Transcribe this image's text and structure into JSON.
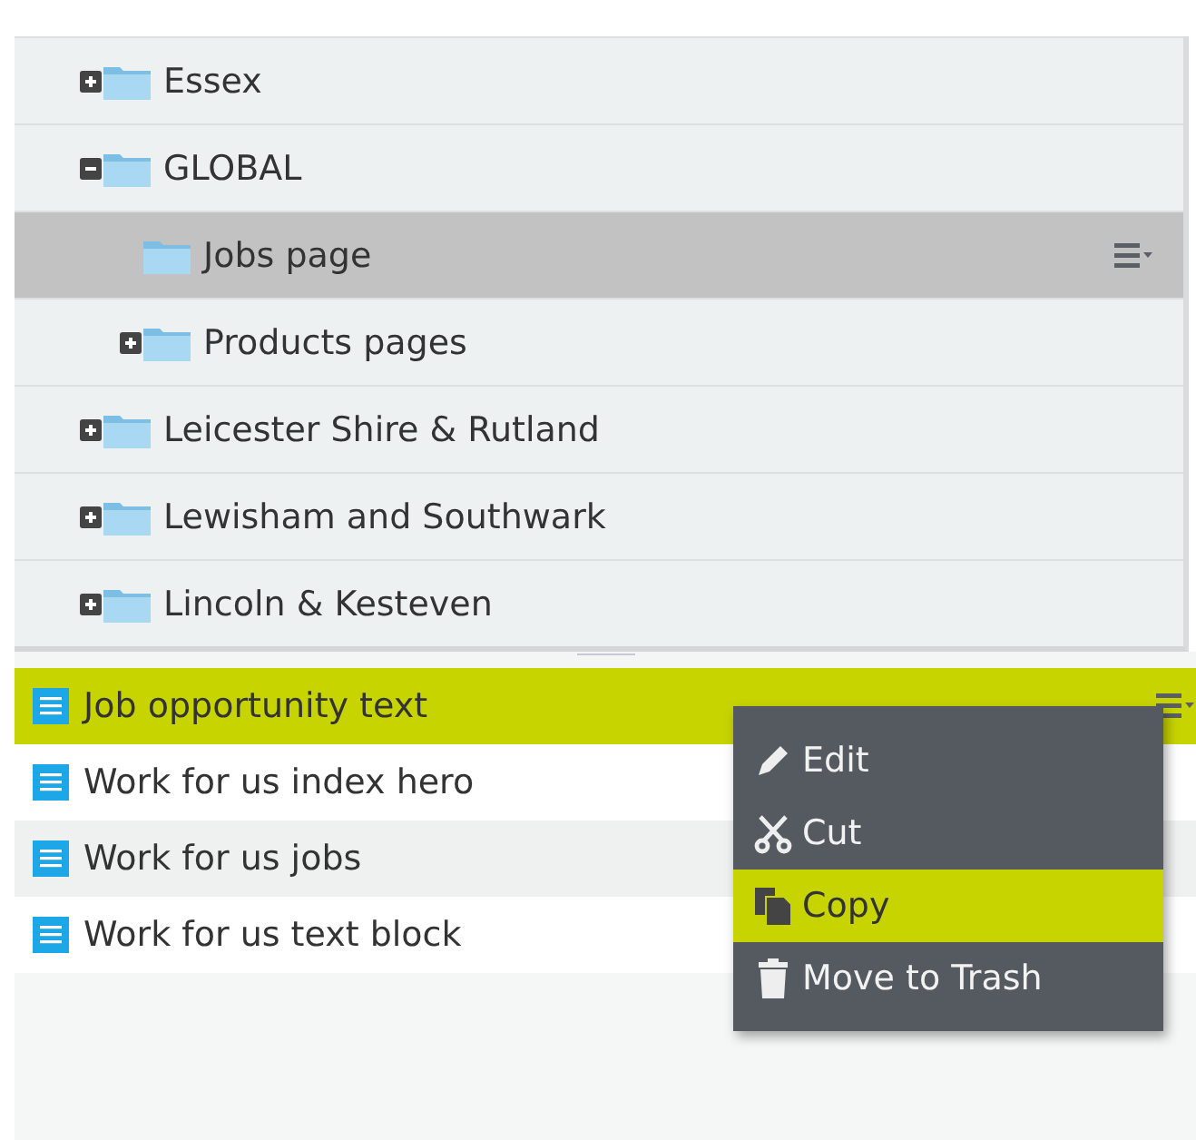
{
  "tree": [
    {
      "label": "Essex",
      "kind": "folder",
      "expanded": false,
      "selected": false
    },
    {
      "label": "GLOBAL",
      "kind": "folder",
      "expanded": true,
      "selected": false,
      "children": [
        {
          "label": "Jobs page",
          "kind": "leaf",
          "selected": true
        },
        {
          "label": "Products pages",
          "kind": "folder",
          "expanded": false,
          "selected": false
        }
      ]
    },
    {
      "label": "Leicester Shire & Rutland",
      "kind": "folder",
      "expanded": false,
      "selected": false
    },
    {
      "label": "Lewisham and Southwark",
      "kind": "folder",
      "expanded": false,
      "selected": false
    },
    {
      "label": "Lincoln & Kesteven",
      "kind": "folder",
      "expanded": false,
      "selected": false
    }
  ],
  "list": [
    {
      "label": "Job opportunity text",
      "selected": true
    },
    {
      "label": "Work for us index hero",
      "selected": false
    },
    {
      "label": "Work for us jobs",
      "selected": false
    },
    {
      "label": "Work for us text block",
      "selected": false
    }
  ],
  "context_menu": [
    {
      "label": "Edit",
      "kind": "edit",
      "selected": false
    },
    {
      "label": "Cut",
      "kind": "cut",
      "selected": false
    },
    {
      "label": "Copy",
      "kind": "copy",
      "selected": true
    },
    {
      "label": "Move to Trash",
      "kind": "trash",
      "selected": false
    }
  ]
}
